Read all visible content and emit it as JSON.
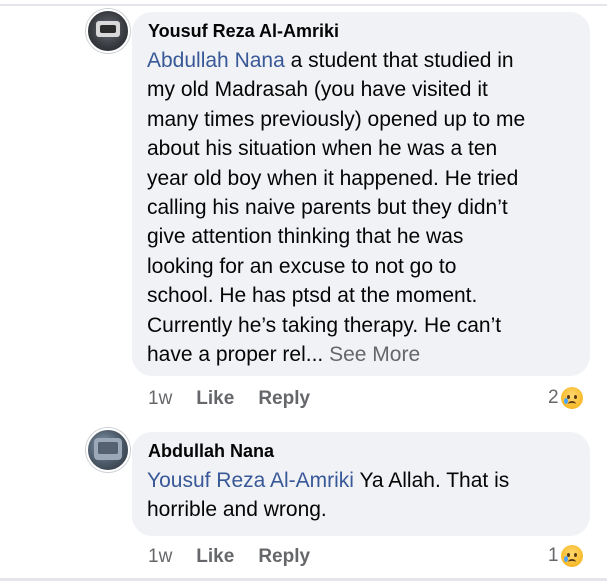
{
  "comments": [
    {
      "author": "Yousuf Reza Al-Amriki",
      "mention": "Abdullah Nana",
      "lines": [
        " a student that studied in",
        "my old Madrasah (you have visited it",
        "many times previously) opened up to me",
        "about his situation when he was a ten",
        "year old boy when it happened. He tried",
        "calling his naive parents but they didn’t",
        "give attention thinking that he was",
        "looking for an excuse to not go to",
        "school. He has ptsd at the moment.",
        "Currently he’s taking therapy. He can’t",
        "have a proper rel... "
      ],
      "see_more": "See More",
      "time": "1w",
      "like": "Like",
      "reply": "Reply",
      "reaction_count": "2",
      "reaction_icon": "sad-emoji-icon"
    },
    {
      "author": "Abdullah Nana",
      "mention": "Yousuf Reza Al-Amriki",
      "lines": [
        " Ya Allah. That is",
        "horrible and wrong."
      ],
      "time": "1w",
      "like": "Like",
      "reply": "Reply",
      "reaction_count": "1",
      "reaction_icon": "sad-emoji-icon"
    }
  ],
  "colors": {
    "bubble": "#f0f2f5",
    "mention": "#385898",
    "secondary_text": "#65676b"
  }
}
